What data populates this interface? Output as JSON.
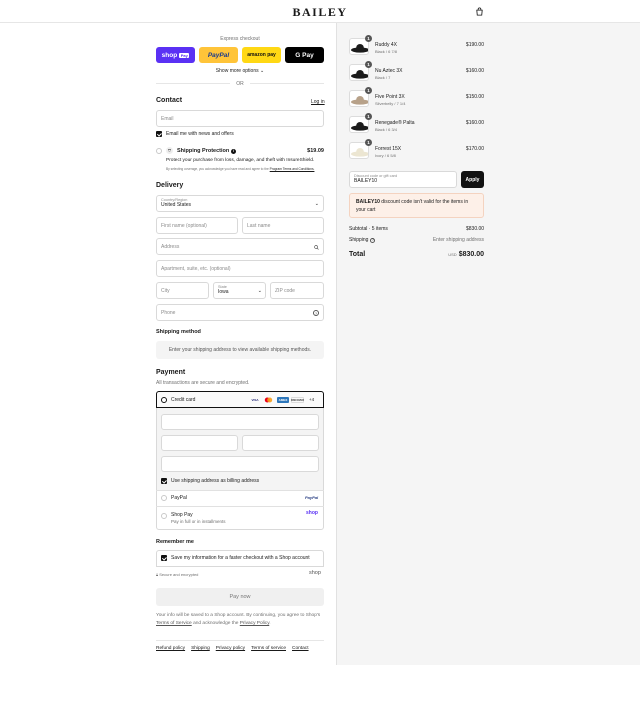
{
  "header": {
    "brand": "BAILEY"
  },
  "express": {
    "label": "Express checkout",
    "buttons": [
      {
        "label": "shop",
        "sub": "Pay",
        "color": "#5a31f4"
      },
      {
        "label": "PayPal",
        "color": "#ffc439"
      },
      {
        "label": "amazon pay",
        "color": "#ffd814"
      },
      {
        "label": "G Pay",
        "color": "#000000"
      }
    ],
    "show_more": "Show more options",
    "or": "OR"
  },
  "contact": {
    "title": "Contact",
    "login": "Log in",
    "email_placeholder": "Email",
    "news_label": "Email me with news and offers"
  },
  "protection": {
    "title": "Shipping Protection",
    "price": "$19.09",
    "desc": "Protect your purchase from loss, damage, and theft with InsureShield.",
    "legal": "By selecting coverage, you acknowledge you have read and agree to the",
    "legal_link": "Program Terms and Conditions."
  },
  "delivery": {
    "title": "Delivery",
    "country_label": "Country/Region",
    "country_value": "United States",
    "first_name": "First name (optional)",
    "last_name": "Last name",
    "address": "Address",
    "apartment": "Apartment, suite, etc. (optional)",
    "city": "City",
    "state_label": "State",
    "state_value": "Iowa",
    "zip": "ZIP code",
    "phone": "Phone"
  },
  "shipping_method": {
    "title": "Shipping method",
    "message": "Enter your shipping address to view available shipping methods."
  },
  "payment": {
    "title": "Payment",
    "subtitle": "All transactions are secure and encrypted.",
    "credit_card": "Credit card",
    "card_logos": [
      "VISA",
      "MC",
      "AMEX",
      "DISCOVER"
    ],
    "more_cards": "+4",
    "billing_label": "Use shipping address as billing address",
    "paypal": "PayPal",
    "paypal_logo": "PayPal",
    "shoppay": "Shop Pay",
    "shoppay_sub": "Pay in full or in installments",
    "shoppay_logo": "shop"
  },
  "remember": {
    "title": "Remember me",
    "save_label": "Save my information for a faster checkout with a Shop account",
    "secure": "Secure and encrypted",
    "shop_logo": "shop"
  },
  "pay_now": "Pay now",
  "disclaimer": {
    "text": "Your info will be saved to a Shop account. By continuing, you agree to Shop's",
    "tos": "Terms of Service",
    "and": "and acknowledge the",
    "privacy": "Privacy Policy"
  },
  "footer_links": [
    "Refund policy",
    "Shipping",
    "Privacy policy",
    "Terms of service",
    "Contact"
  ],
  "order": {
    "items": [
      {
        "name": "Ruddy 4X",
        "variant": "Black / 6 7/8",
        "price": "$190.00",
        "qty": "1",
        "hat": "black"
      },
      {
        "name": "Nu Aztec 3X",
        "variant": "Black / 7",
        "price": "$160.00",
        "qty": "1",
        "hat": "black"
      },
      {
        "name": "Five Point 3X",
        "variant": "Silverbelly / 7 1/4",
        "price": "$150.00",
        "qty": "1",
        "hat": "tan"
      },
      {
        "name": "Renegade® Palta",
        "variant": "Black / 6 3/4",
        "price": "$160.00",
        "qty": "1",
        "hat": "black"
      },
      {
        "name": "Forrest 15X",
        "variant": "Ivory / 6 5/8",
        "price": "$170.00",
        "qty": "1",
        "hat": "ivory"
      }
    ],
    "discount_label": "Discount code or gift card",
    "discount_value": "BAILEY10",
    "apply": "Apply",
    "error_code": "BAILEY10",
    "error_text": "discount code isn't valid for the items in your cart",
    "subtotal_label": "Subtotal · 5 items",
    "subtotal_value": "$830.00",
    "shipping_label": "Shipping",
    "shipping_value": "Enter shipping address",
    "total_label": "Total",
    "currency": "USD",
    "total_value": "$830.00"
  }
}
